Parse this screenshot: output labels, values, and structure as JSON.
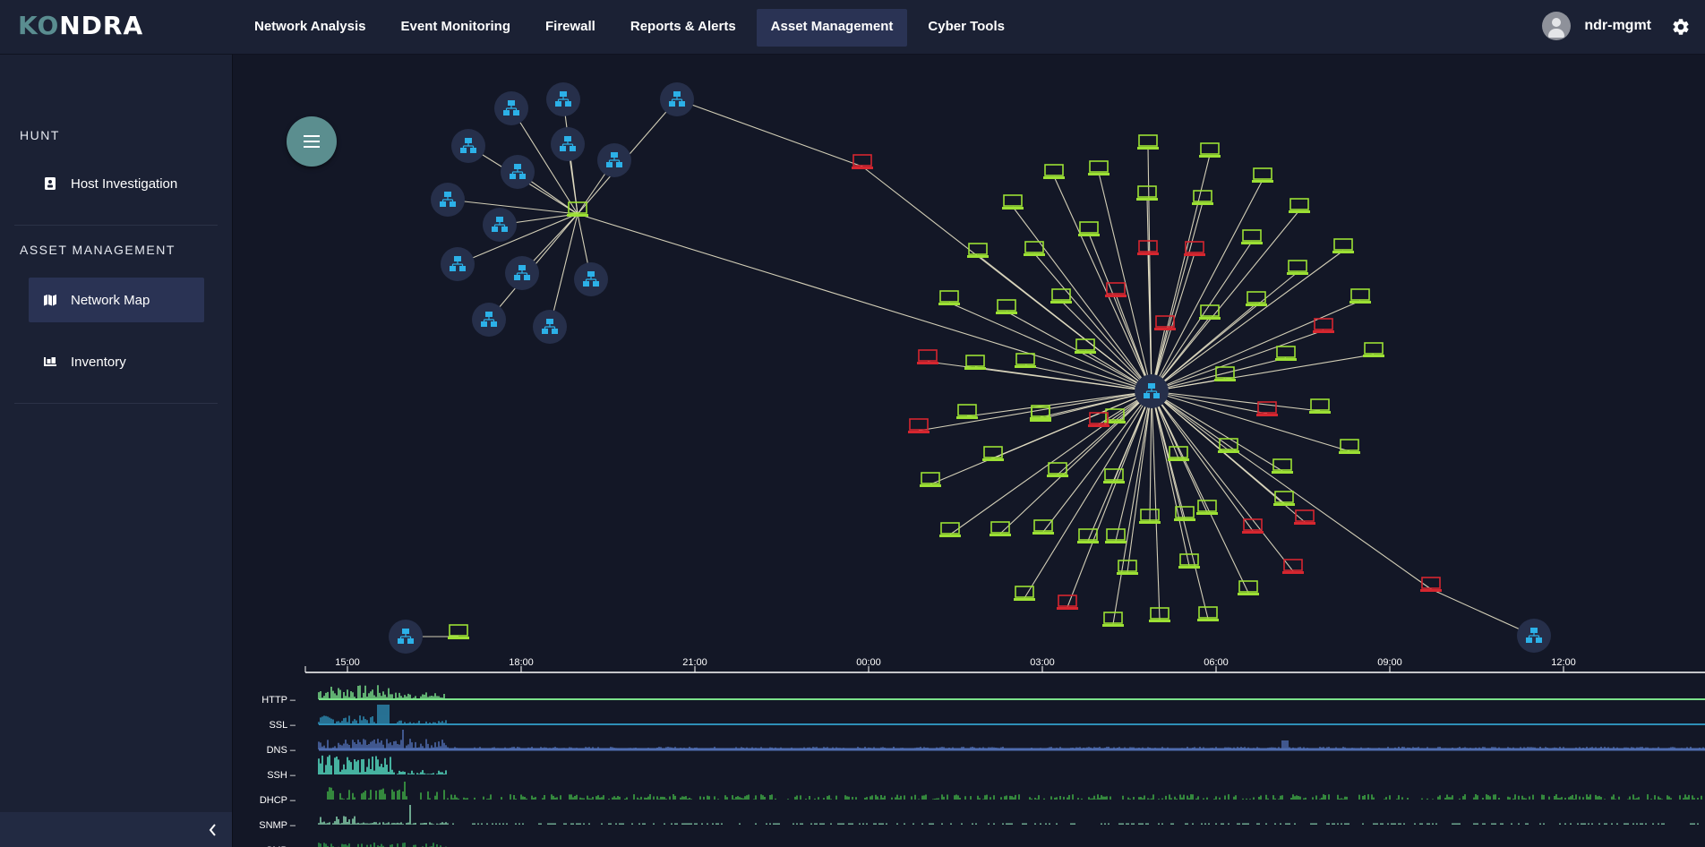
{
  "app": {
    "logo_part1": "KO",
    "logo_part2": "NDRA"
  },
  "nav": {
    "items": [
      {
        "label": "Network Analysis"
      },
      {
        "label": "Event Monitoring"
      },
      {
        "label": "Firewall"
      },
      {
        "label": "Reports & Alerts"
      },
      {
        "label": "Asset Management",
        "active": true
      },
      {
        "label": "Cyber Tools"
      }
    ]
  },
  "user": {
    "name": "ndr-mgmt"
  },
  "sidebar": {
    "sections": [
      {
        "heading": "HUNT",
        "items": [
          {
            "label": "Host Investigation",
            "icon": "id-badge-icon"
          }
        ]
      },
      {
        "heading": "ASSET MANAGEMENT",
        "items": [
          {
            "label": "Network Map",
            "icon": "map-icon",
            "active": true
          },
          {
            "label": "Inventory",
            "icon": "inventory-icon"
          }
        ]
      }
    ]
  },
  "timeline": {
    "ticks": [
      "15:00",
      "18:00",
      "21:00",
      "00:00",
      "03:00",
      "06:00",
      "09:00",
      "12:00"
    ],
    "protocols": [
      {
        "label": "HTTP",
        "color": "#7be28a"
      },
      {
        "label": "SSL",
        "color": "#2e8fb7"
      },
      {
        "label": "DNS",
        "color": "#4f6db0"
      },
      {
        "label": "SSH",
        "color": "#57e6c8"
      },
      {
        "label": "DHCP",
        "color": "#3fae45"
      },
      {
        "label": "SNMP",
        "color": "#8ad7b0"
      },
      {
        "label": "SMB",
        "color": "#2f9a4a"
      }
    ]
  },
  "colors": {
    "accent": "#5b8e8f",
    "host_normal": "#9ce034",
    "host_alert": "#d6262f",
    "router": "#2cb1e8",
    "node_bg": "#262f4a",
    "edge": "#e9e3c8"
  }
}
